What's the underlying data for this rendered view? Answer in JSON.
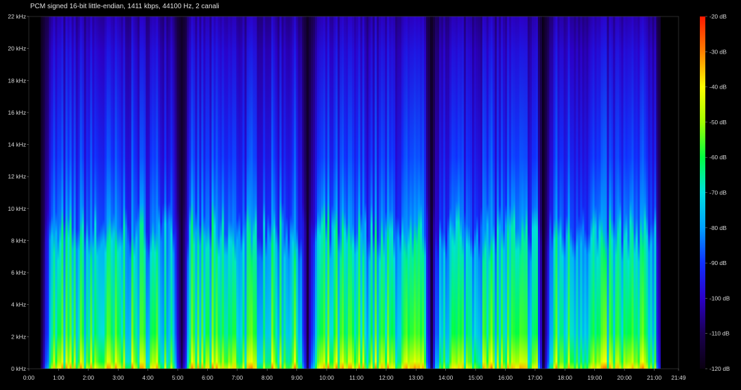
{
  "header": {
    "info": "PCM signed 16-bit little-endian, 1411 kbps, 44100 Hz, 2 canali"
  },
  "colors": {
    "background": "#000000",
    "colormap": [
      "#0a0010",
      "#1a0050",
      "#2b00c8",
      "#1030ff",
      "#00a0ff",
      "#00e0e0",
      "#00ff40",
      "#a0ff00",
      "#ffff00",
      "#ff8000",
      "#ff1800"
    ]
  },
  "chart_data": {
    "type": "heatmap",
    "title": "PCM signed 16-bit little-endian, 1411 kbps, 44100 Hz, 2 canali",
    "xlabel": "",
    "ylabel": "",
    "x_ticks": [
      "0:00",
      "1:00",
      "2:00",
      "3:00",
      "4:00",
      "5:00",
      "6:00",
      "7:00",
      "8:00",
      "9:00",
      "10:00",
      "11:00",
      "12:00",
      "13:00",
      "14:00",
      "15:00",
      "16:00",
      "17:00",
      "18:00",
      "19:00",
      "20:00",
      "21:00",
      "21:49"
    ],
    "x_tick_seconds": [
      0,
      60,
      120,
      180,
      240,
      300,
      360,
      420,
      480,
      540,
      600,
      660,
      720,
      780,
      840,
      900,
      960,
      1020,
      1080,
      1140,
      1200,
      1260,
      1309
    ],
    "xlim_seconds": [
      0,
      1309
    ],
    "y_ticks": [
      "0 kHz",
      "2 kHz",
      "4 kHz",
      "6 kHz",
      "8 kHz",
      "10 kHz",
      "12 kHz",
      "14 kHz",
      "16 kHz",
      "18 kHz",
      "20 kHz",
      "22 kHz"
    ],
    "y_tick_khz": [
      0,
      2,
      4,
      6,
      8,
      10,
      12,
      14,
      16,
      18,
      20,
      22
    ],
    "ylim_khz": [
      0,
      22
    ],
    "colorbar_ticks": [
      "-20 dB",
      "-30 dB",
      "-40 dB",
      "-50 dB",
      "-60 dB",
      "-70 dB",
      "-80 dB",
      "-90 dB",
      "-100 dB",
      "-110 dB",
      "-120 dB"
    ],
    "colorbar_db": [
      -20,
      -30,
      -40,
      -50,
      -60,
      -70,
      -80,
      -90,
      -100,
      -110,
      -120
    ],
    "db_range": [
      -120,
      -20
    ],
    "tracks": [
      {
        "start": 24,
        "end": 304
      },
      {
        "start": 306,
        "end": 558
      },
      {
        "start": 560,
        "end": 808
      },
      {
        "start": 810,
        "end": 1033
      },
      {
        "start": 1036,
        "end": 1271
      }
    ]
  }
}
